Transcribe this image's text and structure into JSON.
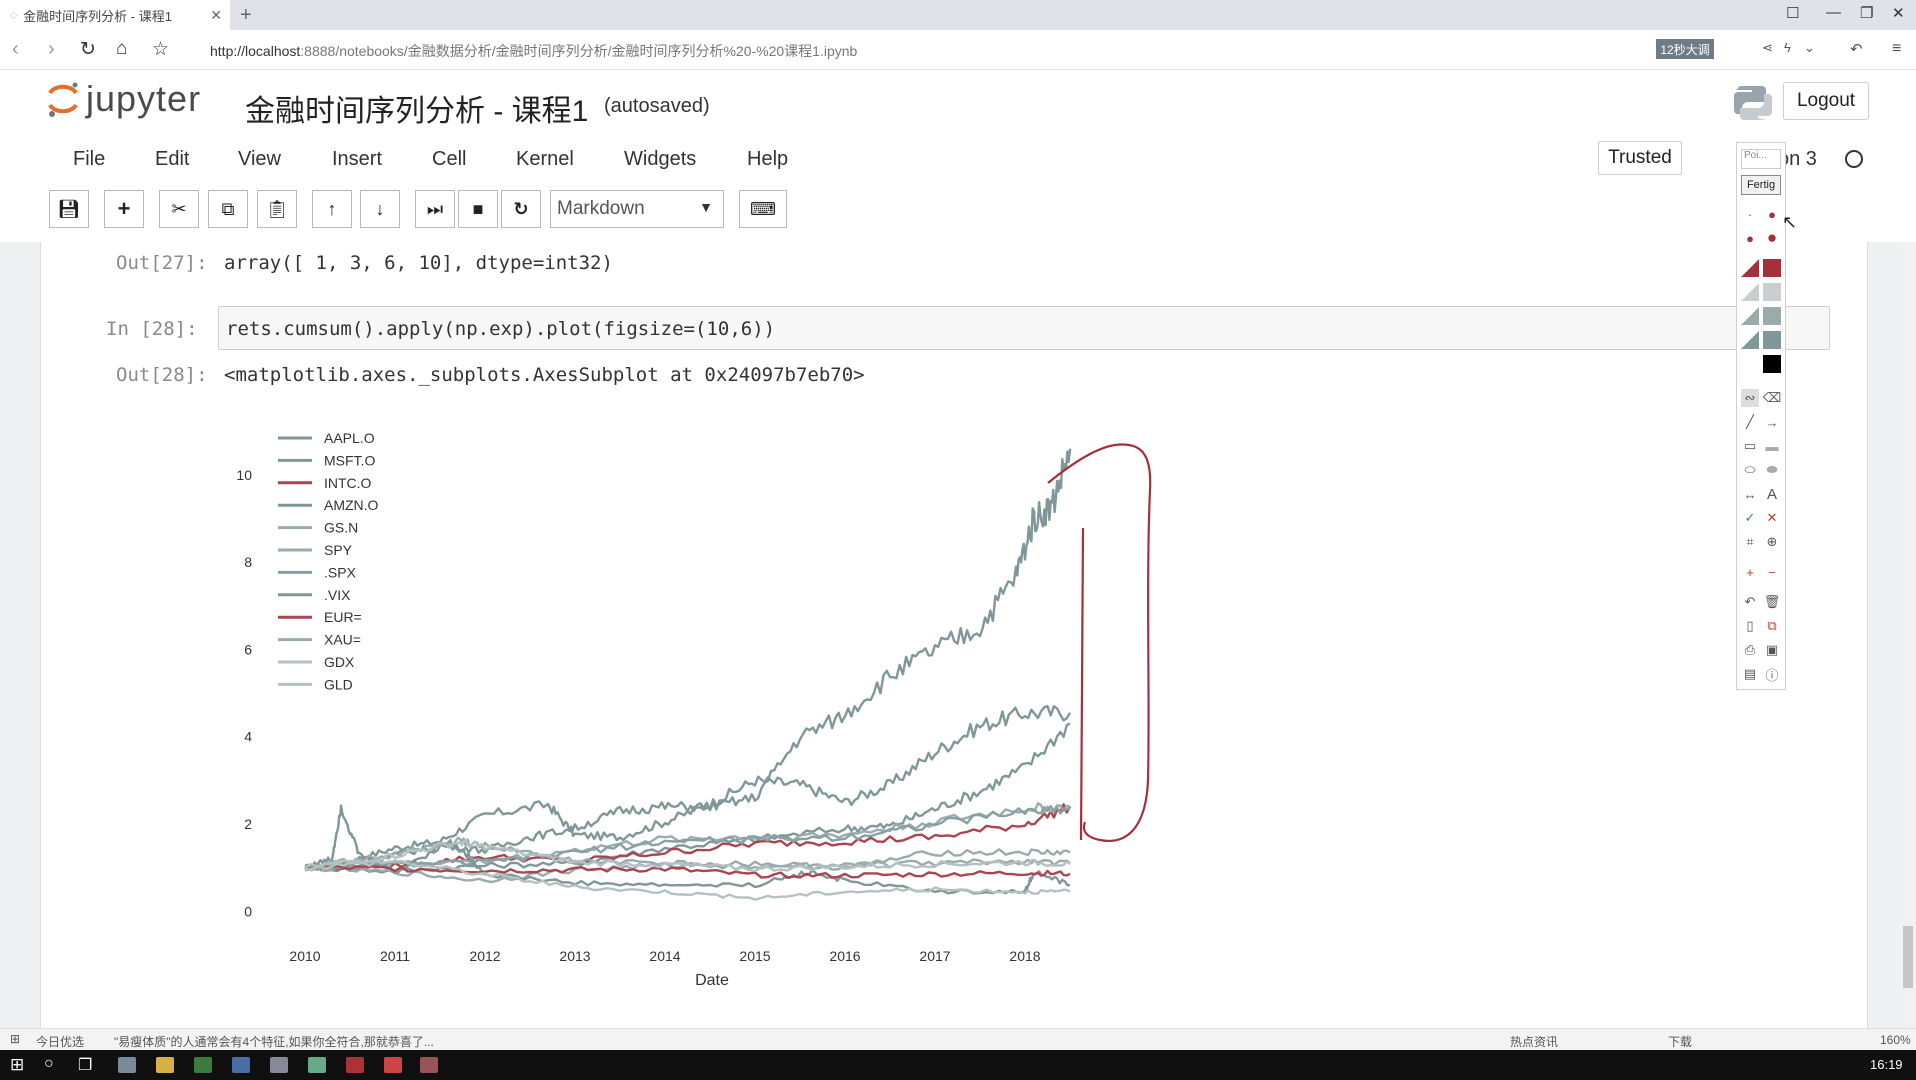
{
  "browser": {
    "tab_title": "金融时间序列分析 - 课程1",
    "url_host": "http://localhost",
    "url_rest": ":8888/notebooks/金融数据分析/金融时间序列分析/金融时间序列分析%20-%20课程1.ipynb",
    "chip_label": "12秒大调"
  },
  "header": {
    "logo_word": "jupyter",
    "notebook_title": "金融时间序列分析 - 课程1",
    "autosave": "(autosaved)",
    "logout_label": "Logout",
    "trusted_label": "Trusted",
    "kernel_label": "on 3"
  },
  "menu": [
    "File",
    "Edit",
    "View",
    "Insert",
    "Cell",
    "Kernel",
    "Widgets",
    "Help"
  ],
  "toolbar": {
    "cell_type": "Markdown"
  },
  "cells": {
    "out27_prompt": "Out[27]:",
    "out27_text": "array([ 1,   3,   6,  10], dtype=int32)",
    "in28_prompt": "In  [28]:",
    "in28_code": "rets.cumsum().apply(np.exp).plot(figsize=(10,6))",
    "out28_prompt": "Out[28]:",
    "out28_text": "<matplotlib.axes._subplots.AxesSubplot at 0x24097b7eb70>"
  },
  "palette": {
    "field": "Poi...",
    "done": "Fertig"
  },
  "statusbar": {
    "left": "今日优选",
    "news": "\"易瘦体质\"的人通常会有4个特征,如果你全符合,那就恭喜了...",
    "right1": "热点资讯",
    "right2": "下载",
    "zoom": "160%"
  },
  "taskbar": {
    "time": "16:19"
  },
  "colors": {
    "line_gray": "#7f9798",
    "line_red": "#a9464f",
    "annot_red": "#a4303c"
  },
  "chart_data": {
    "type": "line",
    "xlabel": "Date",
    "ylabel": "",
    "xlim": [
      2010,
      2018.5
    ],
    "ylim": [
      -0.2,
      10.8
    ],
    "xticks": [
      "2010",
      "2011",
      "2012",
      "2013",
      "2014",
      "2015",
      "2016",
      "2017",
      "2018"
    ],
    "yticks": [
      "0",
      "2",
      "4",
      "6",
      "8",
      "10"
    ],
    "legend_position": "top-left",
    "series": [
      {
        "name": "AAPL.O",
        "color": "#7f9798",
        "x": [
          2010,
          2010.5,
          2011,
          2011.5,
          2012,
          2012.7,
          2013,
          2013.5,
          2014,
          2014.5,
          2015,
          2015.5,
          2016,
          2016.5,
          2017,
          2017.5,
          2018,
          2018.5
        ],
        "y": [
          1,
          1.15,
          1.45,
          1.6,
          2.2,
          2.45,
          1.75,
          1.7,
          2.05,
          2.45,
          3.0,
          2.9,
          2.5,
          2.9,
          3.65,
          4.25,
          4.55,
          4.55
        ]
      },
      {
        "name": "MSFT.O",
        "color": "#7f9798",
        "x": [
          2010,
          2011,
          2012,
          2013,
          2014,
          2015,
          2016,
          2016.5,
          2017,
          2017.5,
          2018,
          2018.5
        ],
        "y": [
          1,
          0.92,
          1.05,
          1.1,
          1.45,
          1.65,
          1.9,
          1.95,
          2.35,
          2.75,
          3.3,
          4.3
        ]
      },
      {
        "name": "INTC.O",
        "color": "#a9464f",
        "x": [
          2010,
          2011,
          2012,
          2013,
          2014,
          2015,
          2016,
          2017,
          2018,
          2018.5
        ],
        "y": [
          1,
          1.05,
          1.25,
          1.15,
          1.35,
          1.55,
          1.6,
          1.7,
          2.0,
          2.4
        ]
      },
      {
        "name": "AMZN.O",
        "color": "#7f9798",
        "x": [
          2010,
          2010.5,
          2011,
          2011.5,
          2012,
          2012.5,
          2013,
          2013.5,
          2014,
          2014.5,
          2015,
          2015.5,
          2016,
          2016.5,
          2017,
          2017.5,
          2017.9,
          2018.1,
          2018.3,
          2018.5
        ],
        "y": [
          1,
          1.0,
          1.3,
          1.5,
          1.4,
          1.7,
          1.9,
          2.3,
          2.4,
          2.4,
          2.6,
          4.0,
          4.5,
          5.4,
          6.0,
          6.5,
          7.7,
          9.0,
          9.3,
          10.6
        ]
      },
      {
        "name": "GS.N",
        "color": "#9aabac",
        "x": [
          2010,
          2011,
          2012,
          2013,
          2014,
          2015,
          2016,
          2017,
          2018,
          2018.5
        ],
        "y": [
          1,
          0.9,
          0.7,
          0.95,
          1.05,
          1.1,
          1.0,
          1.35,
          1.35,
          1.35
        ]
      },
      {
        "name": "SPY",
        "color": "#9aabac",
        "x": [
          2010,
          2011,
          2012,
          2013,
          2014,
          2015,
          2016,
          2017,
          2018,
          2018.5
        ],
        "y": [
          1,
          1.1,
          1.15,
          1.4,
          1.65,
          1.7,
          1.75,
          2.05,
          2.35,
          2.4
        ]
      },
      {
        "name": ".SPX",
        "color": "#88a0a1",
        "x": [
          2010,
          2011,
          2012,
          2013,
          2014,
          2015,
          2016,
          2017,
          2018,
          2018.5
        ],
        "y": [
          1,
          1.08,
          1.12,
          1.35,
          1.6,
          1.65,
          1.7,
          2.0,
          2.3,
          2.35
        ]
      },
      {
        "name": ".VIX",
        "color": "#7f9798",
        "x": [
          2010,
          2010.3,
          2010.4,
          2010.6,
          2011,
          2011.6,
          2011.8,
          2012,
          2013,
          2014,
          2015,
          2015.6,
          2016,
          2017,
          2018,
          2018.1,
          2018.5
        ],
        "y": [
          1,
          1.2,
          2.4,
          1.3,
          0.9,
          1.6,
          1.3,
          0.85,
          0.65,
          0.6,
          0.6,
          0.9,
          0.7,
          0.45,
          0.45,
          0.9,
          0.6
        ]
      },
      {
        "name": "EUR=",
        "color": "#a9464f",
        "x": [
          2010,
          2011,
          2012,
          2013,
          2014,
          2015,
          2016,
          2017,
          2018,
          2018.5
        ],
        "y": [
          1,
          0.98,
          0.93,
          0.95,
          0.97,
          0.83,
          0.82,
          0.85,
          0.88,
          0.86
        ]
      },
      {
        "name": "XAU=",
        "color": "#9aabac",
        "x": [
          2010,
          2011,
          2011.7,
          2012,
          2013,
          2014,
          2015,
          2016,
          2017,
          2018,
          2018.5
        ],
        "y": [
          1,
          1.3,
          1.6,
          1.5,
          1.15,
          1.1,
          1.0,
          1.05,
          1.1,
          1.15,
          1.1
        ]
      },
      {
        "name": "GDX",
        "color": "#b4c1c2",
        "x": [
          2010,
          2011,
          2012,
          2013,
          2014,
          2015,
          2016,
          2017,
          2018,
          2018.5
        ],
        "y": [
          1,
          1.15,
          0.85,
          0.55,
          0.45,
          0.3,
          0.45,
          0.5,
          0.45,
          0.45
        ]
      },
      {
        "name": "GLD",
        "color": "#b4c1c2",
        "x": [
          2010,
          2011,
          2011.7,
          2012,
          2013,
          2014,
          2015,
          2016,
          2017,
          2018,
          2018.5
        ],
        "y": [
          1,
          1.28,
          1.58,
          1.48,
          1.12,
          1.08,
          0.97,
          1.02,
          1.08,
          1.12,
          1.08
        ]
      }
    ]
  }
}
